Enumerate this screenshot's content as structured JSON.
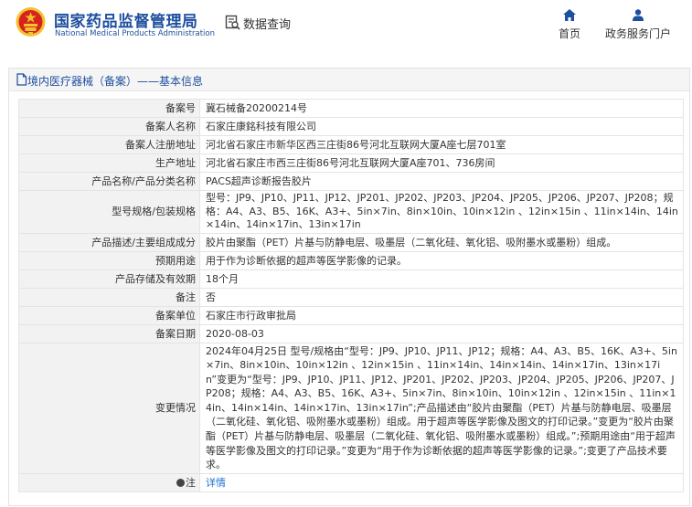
{
  "header": {
    "brand_cn": "国家药品监督管理局",
    "brand_en": "National Medical Products Administration",
    "query_label": "数据查询",
    "nav": [
      {
        "label": "首页",
        "icon": "home-icon"
      },
      {
        "label": "政务服务门户",
        "icon": "user-icon"
      }
    ]
  },
  "panel": {
    "title": "境内医疗器械（备案）——基本信息"
  },
  "rows": [
    {
      "label": "备案号",
      "value": "冀石械备20200214号"
    },
    {
      "label": "备案人名称",
      "value": "石家庄康銘科技有限公司"
    },
    {
      "label": "备案人注册地址",
      "value": "河北省石家庄市新华区西三庄街86号河北互联网大厦A座七层701室"
    },
    {
      "label": "生产地址",
      "value": "河北省石家庄市西三庄街86号河北互联网大厦A座701、736房间"
    },
    {
      "label": "产品名称/产品分类名称",
      "value": "PACS超声诊断报告胶片"
    },
    {
      "label": "型号规格/包装规格",
      "value": "型号：JP9、JP10、JP11、JP12、JP201、JP202、JP203、JP204、JP205、JP206、JP207、JP208；规格：A4、A3、B5、16K、A3+、5in×7in、8in×10in、10in×12in 、12in×15in 、11in×14in、14in×14in、14in×17in、13in×17in"
    },
    {
      "label": "产品描述/主要组成成分",
      "value": "胶片由聚酯（PET）片基与防静电层、吸墨层（二氧化硅、氧化铝、吸附墨水或墨粉）组成。"
    },
    {
      "label": "预期用途",
      "value": "用于作为诊断依据的超声等医学影像的记录。"
    },
    {
      "label": "产品存储及有效期",
      "value": "18个月"
    },
    {
      "label": "备注",
      "value": "否"
    },
    {
      "label": "备案单位",
      "value": "石家庄市行政审批局"
    },
    {
      "label": "备案日期",
      "value": "2020-08-03"
    },
    {
      "label": "变更情况",
      "value": "2024年04月25日 型号/规格由“型号：JP9、JP10、JP11、JP12；规格：A4、A3、B5、16K、A3+、5in×7in、8in×10in、10in×12in 、12in×15in 、11in×14in、14in×14in、14in×17in、13in×17in”变更为“型号：JP9、JP10、JP11、JP12、JP201、JP202、JP203、JP204、JP205、JP206、JP207、JP208；规格：A4、A3、B5、16K、A3+、5in×7in、8in×10in、10in×12in 、12in×15in 、11in×14in、14in×14in、14in×17in、13in×17in”;产品描述由“胶片由聚酯（PET）片基与防静电层、吸墨层（二氧化硅、氧化铝、吸附墨水或墨粉）组成。用于超声等医学影像及图文的打印记录。”变更为“胶片由聚酯（PET）片基与防静电层、吸墨层（二氧化硅、氧化铝、吸附墨水或墨粉）组成。”;预期用途由“用于超声等医学影像及图文的打印记录。”变更为“用于作为诊断依据的超声等医学影像的记录。”;变更了产品技术要求。"
    },
    {
      "label": "注",
      "value": "详情"
    }
  ],
  "colors": {
    "brand_blue": "#1e4f9e",
    "link_blue": "#1e6fd2",
    "emblem_red": "#d7231e",
    "emblem_gold": "#f2c230"
  }
}
